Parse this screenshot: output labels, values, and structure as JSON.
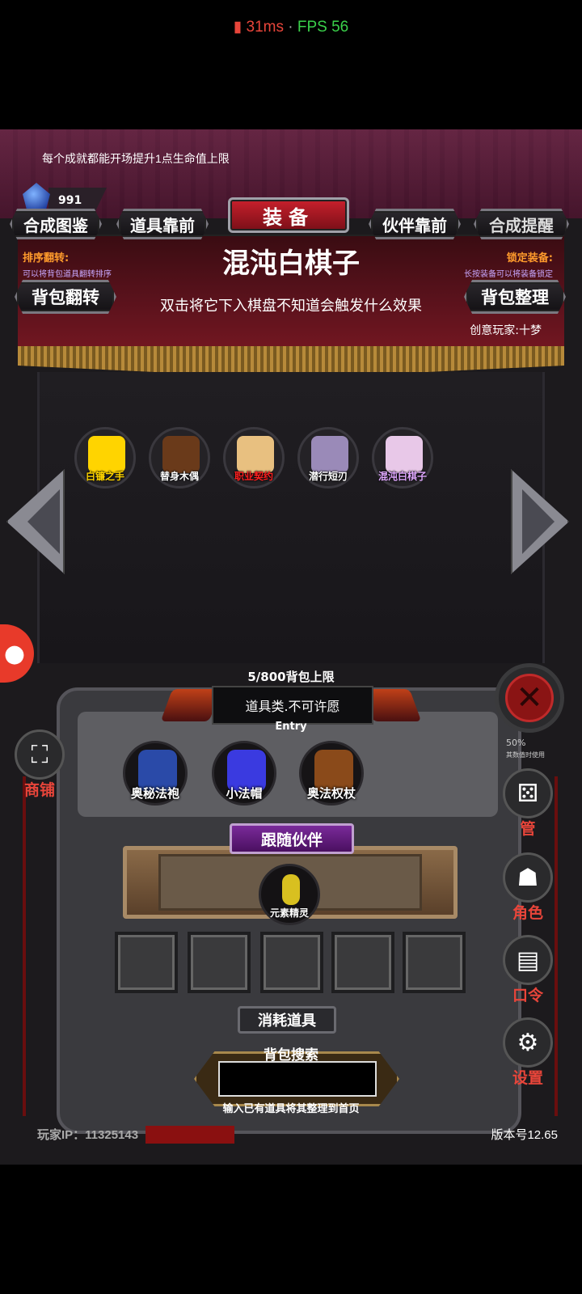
{
  "status": {
    "ping": "31ms",
    "separator": "·",
    "fps": "FPS 56"
  },
  "tip": "每个成就都能开场提升1点生命值上限",
  "gem_count": "991",
  "top_buttons": {
    "recipe_book": "合成图鉴",
    "items_first": "道具靠前",
    "title": "装备",
    "partners_first": "伙伴靠前",
    "craft_remind": "合成提醒",
    "bag_flip": "背包翻转",
    "bag_sort": "背包整理"
  },
  "labels": {
    "sort_flip": "排序翻转:",
    "sort_flip_desc": "可以将背包道具翻转排序",
    "lock_equip": "锁定装备:",
    "lock_equip_desc": "长按装备可以将装备锁定"
  },
  "selected_item": {
    "name": "混沌白棋子",
    "description": "双击将它下入棋盘不知道会触发什么效果",
    "author": "创意玩家:十梦"
  },
  "equipped": [
    {
      "name": "白镰之手",
      "icon": "claw-icon",
      "color": "#ffd400",
      "name_color": "#ffd400"
    },
    {
      "name": "替身木偶",
      "icon": "wooden-puppet-icon",
      "color": "#6a3a1a",
      "name_color": "#ffffff"
    },
    {
      "name": "职业契约",
      "icon": "scroll-icon",
      "color": "#e8c080",
      "name_color": "#ff2020"
    },
    {
      "name": "潜行短刃",
      "icon": "dagger-icon",
      "color": "#9a8ab8",
      "name_color": "#ffffff"
    },
    {
      "name": "混沌白棋子",
      "icon": "chess-piece-icon",
      "color": "#e8c8e8",
      "name_color": "#e0a8ff"
    }
  ],
  "capacity": "5/800背包上限",
  "wish_category": "道具类.不可许愿",
  "entry": "Entry",
  "bag_items": [
    {
      "name": "奥秘法袍",
      "icon": "robe-icon",
      "color": "#2a4aa8"
    },
    {
      "name": "小法帽",
      "icon": "wizard-hat-icon",
      "color": "#3a3ae0"
    },
    {
      "name": "奥法权杖",
      "icon": "staff-icon",
      "color": "#8a4a1a"
    }
  ],
  "follow_title": "跟随伙伴",
  "partner": {
    "name": "元素精灵",
    "icon": "elemental-spirit-icon",
    "color": "#d8c020"
  },
  "consumables_title": "消耗道具",
  "search": {
    "label": "背包搜索",
    "placeholder": "",
    "hint": "输入已有道具将其整理到首页"
  },
  "footer": {
    "player_ip": "玩家IP：11325143",
    "version": "版本号12.65"
  },
  "side_menu": {
    "shop": "商铺",
    "manage": "管",
    "role": "角色",
    "password": "口令",
    "settings": "设置"
  },
  "small_text": {
    "pct": "50%",
    "desc": "其数值时使用"
  },
  "colors": {
    "accent_red": "#e8453a",
    "title_red": "#c8202c",
    "label_orange": "#ff9b2c"
  }
}
